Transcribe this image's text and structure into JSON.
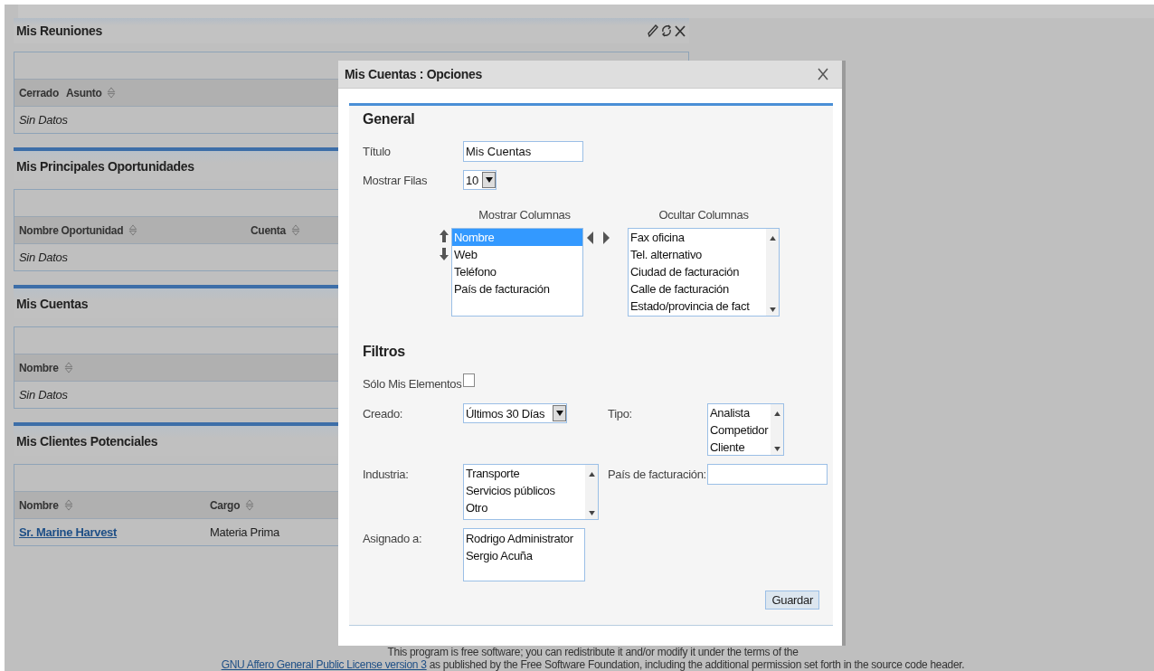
{
  "dashlets": [
    {
      "title": "Mis Reuniones",
      "actions": true,
      "columns": [
        {
          "label": "Cerrado",
          "sortable": false
        },
        {
          "label": "Asunto",
          "sortable": true
        }
      ],
      "empty_text": "Sin Datos"
    },
    {
      "title": "Mis Principales Oportunidades",
      "columns": [
        {
          "label": "Nombre Oportunidad",
          "sortable": true
        },
        {
          "label": "Cuenta",
          "sortable": true
        }
      ],
      "empty_text": "Sin Datos"
    },
    {
      "title": "Mis Cuentas",
      "columns": [
        {
          "label": "Nombre",
          "sortable": true
        }
      ],
      "empty_text": "Sin Datos"
    },
    {
      "title": "Mis Clientes Potenciales",
      "columns": [
        {
          "label": "Nombre",
          "sortable": true
        },
        {
          "label": "Cargo",
          "sortable": true
        }
      ],
      "rows": [
        [
          {
            "text": "Sr. Marine Harvest",
            "kind": "link"
          },
          {
            "text": "Materia Prima",
            "kind": "text"
          }
        ]
      ]
    }
  ],
  "dialog": {
    "title": "Mis Cuentas : Opciones",
    "general": {
      "heading": "General",
      "title_field": {
        "label": "Título",
        "value": "Mis Cuentas"
      },
      "rows_field": {
        "label": "Mostrar Filas",
        "value": "10"
      },
      "shown_columns": {
        "label": "Mostrar Columnas",
        "items": [
          {
            "label": "Nombre",
            "selected": true
          },
          {
            "label": "Web",
            "selected": false
          },
          {
            "label": "Teléfono",
            "selected": false
          },
          {
            "label": "País de facturación",
            "selected": false
          }
        ]
      },
      "hidden_columns": {
        "label": "Ocultar Columnas",
        "items": [
          {
            "label": "Fax oficina",
            "selected": false
          },
          {
            "label": "Tel. alternativo",
            "selected": false
          },
          {
            "label": "Ciudad de facturación",
            "selected": false
          },
          {
            "label": "Calle de facturación",
            "selected": false
          },
          {
            "label": "Estado/provincia de fact",
            "selected": false
          }
        ]
      }
    },
    "filters": {
      "heading": "Filtros",
      "my_items": {
        "label": "Sólo Mis Elementos",
        "checked": false
      },
      "created": {
        "label": "Creado:",
        "value": "Últimos 30 Días"
      },
      "type": {
        "label": "Tipo:",
        "items": [
          {
            "label": "Analista",
            "selected": false
          },
          {
            "label": "Competidor",
            "selected": false
          },
          {
            "label": "Cliente",
            "selected": false
          }
        ]
      },
      "industry": {
        "label": "Industria:",
        "items": [
          {
            "label": "Transporte",
            "selected": false
          },
          {
            "label": "Servicios públicos",
            "selected": false
          },
          {
            "label": "Otro",
            "selected": false
          }
        ]
      },
      "billing_country": {
        "label": "País de facturación:"
      },
      "assigned": {
        "label": "Asignado a:",
        "items": [
          {
            "label": "Rodrigo Administrator",
            "selected": false
          },
          {
            "label": "Sergio Acuña",
            "selected": false
          }
        ]
      }
    },
    "save_button": "Guardar"
  },
  "footer": {
    "line": "This program is free software; you can redistribute it and/or modify it under the terms of the",
    "link": "GNU Affero General Public License version 3",
    "rest": "as published by the Free Software Foundation, including the additional permission set forth in the source code header."
  }
}
